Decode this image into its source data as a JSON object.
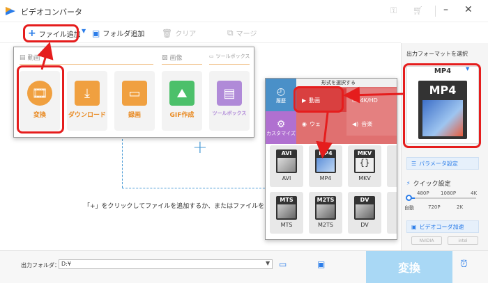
{
  "app": {
    "title": "ビデオコンバータ"
  },
  "toolbar": {
    "add_file": "ファイル追加",
    "add_folder": "フォルダ追加",
    "clear": "クリア",
    "merge": "マージ"
  },
  "drop_hint": "「+」をクリックしてファイルを追加するか、またはファイルをここま",
  "tool_menu": {
    "sections": {
      "video": "動画",
      "image": "画像",
      "toolbox": "ツールボックス"
    },
    "tiles": [
      {
        "label": "変換",
        "icon": "film-reel-icon"
      },
      {
        "label": "ダウンロード",
        "icon": "download-icon"
      },
      {
        "label": "録画",
        "icon": "screen-record-icon"
      },
      {
        "label": "GIF作成",
        "icon": "image-icon"
      },
      {
        "label": "ツールボックス",
        "icon": "toolbox-icon"
      }
    ]
  },
  "format_popup": {
    "header": "形式を選択する",
    "side": [
      {
        "label": "履歴"
      },
      {
        "label": "カスタマイズ"
      }
    ],
    "categories": [
      {
        "label": "動画"
      },
      {
        "label": "4K/HD"
      },
      {
        "label": "ウェ"
      },
      {
        "label": "音楽"
      }
    ],
    "formats": [
      {
        "name": "AVI",
        "label": "AVI"
      },
      {
        "name": "MP4",
        "label": "MP4"
      },
      {
        "name": "MKV",
        "label": "MKV"
      },
      {
        "name": "MTS",
        "label": "MTS"
      },
      {
        "name": "M2TS",
        "label": "M2TS"
      },
      {
        "name": "DV",
        "label": "DV"
      }
    ]
  },
  "right_panel": {
    "title": "出力フォーマットを選択",
    "format": "MP4",
    "param_button": "パラメータ設定",
    "quick_settings": "クイック設定",
    "slider_top": [
      "480P",
      "1080P",
      "4K"
    ],
    "slider_bottom": [
      "自動",
      "720P",
      "2K"
    ],
    "hw_accel": "ビデオコーダ加速",
    "chips": [
      "NVIDIA",
      "intel"
    ]
  },
  "bottom": {
    "output_label": "出力フォルダ：",
    "output_path": "D:¥",
    "convert": "変換"
  },
  "colors": {
    "accent": "#2b7de9",
    "annotation_red": "#e51d1d",
    "tile_orange": "#e98a22",
    "convert_disabled": "#a9d8f5"
  }
}
